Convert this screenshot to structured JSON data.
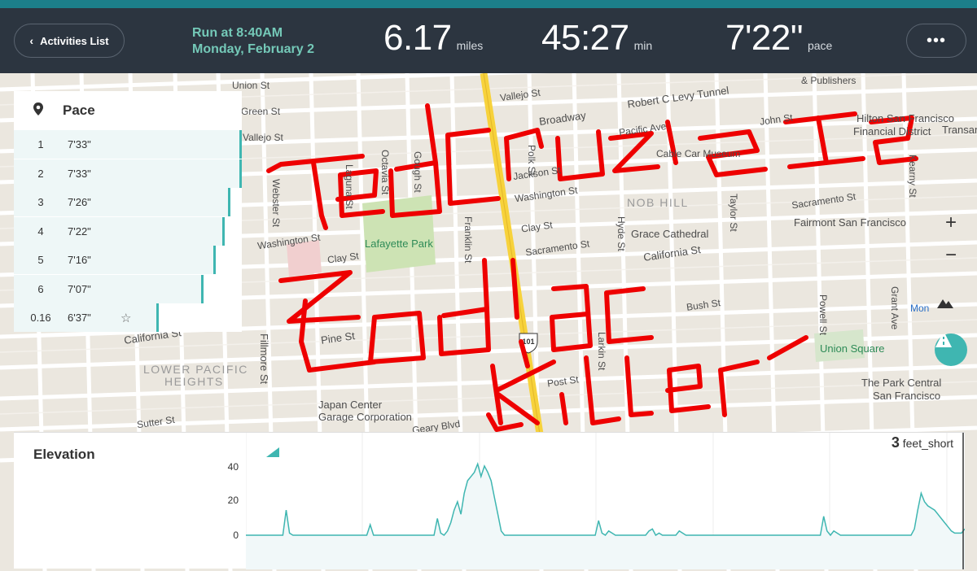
{
  "topbar": {
    "back_label": "Activities List",
    "run_title": "Run at 8:40AM",
    "run_date": "Monday, February 2",
    "distance_value": "6.17",
    "distance_unit": "miles",
    "duration_value": "45:27",
    "duration_unit": "min",
    "pace_value": "7'22\"",
    "pace_unit": "pace",
    "more_label": "•••"
  },
  "pace_panel": {
    "title": "Pace",
    "rows": [
      {
        "mile": "1",
        "pace": "7'33\"",
        "bar_fraction": 0.0
      },
      {
        "mile": "2",
        "pace": "7'33\"",
        "bar_fraction": 0.0
      },
      {
        "mile": "3",
        "pace": "7'26\"",
        "bar_fraction": 0.12
      },
      {
        "mile": "4",
        "pace": "7'22\"",
        "bar_fraction": 0.19
      },
      {
        "mile": "5",
        "pace": "7'16\"",
        "bar_fraction": 0.28
      },
      {
        "mile": "6",
        "pace": "7'07\"",
        "bar_fraction": 0.42
      },
      {
        "mile": "0.16",
        "pace": "6'37\"",
        "bar_fraction": 0.9
      }
    ]
  },
  "map": {
    "streets": [
      "Union St",
      "Green St",
      "Vallejo St",
      "Broadway",
      "Vallejo St",
      "Robert C Levy Tunnel",
      "Pacific Ave",
      "Cable Car Museum",
      "John St",
      "Hilton San Francisco",
      "Financial District",
      "Transam",
      "& Publishers",
      "Jackson St",
      "Washington St",
      "NOB HILL",
      "Sacramento St",
      "Fairmont San Francisco",
      "Clay St",
      "Grace Cathedral",
      "California St",
      "Sacramento St",
      "Washington St",
      "Lafayette Park",
      "Clay St",
      "Webster St",
      "Laguna St",
      "Octavia St",
      "Gough St",
      "Franklin St",
      "Polk St",
      "Hyde St",
      "Larkin St",
      "Taylor St",
      "Powell St",
      "Kearny St",
      "Grant Ave",
      "Pine St",
      "Bush St",
      "Post St",
      "Sutter St",
      "Geary Blvd",
      "Fillmore St",
      "California St",
      "LOWER PACIFIC",
      "HEIGHTS",
      "Japan Center",
      "Garage Corporation",
      "Union Square",
      "The Park Central",
      "San Francisco",
      "101",
      "Mon"
    ],
    "zoom_in": "+",
    "zoom_out": "−",
    "drawing_words": [
      "TedCruz Is",
      "Zodiac",
      "Killer"
    ],
    "route_color": "#ee0000"
  },
  "elevation": {
    "title": "Elevation",
    "cursor_value": "3",
    "cursor_unit": "feet_short",
    "y_ticks": [
      "40",
      "20",
      "0"
    ],
    "ylim": [
      0,
      45
    ],
    "profile": [
      0,
      0,
      0,
      0,
      0,
      0,
      0,
      0,
      0,
      0,
      0,
      0,
      12,
      1,
      0,
      0,
      0,
      0,
      0,
      0,
      0,
      0,
      0,
      0,
      0,
      0,
      0,
      0,
      0,
      0,
      0,
      0,
      0,
      0,
      0,
      0,
      0,
      5,
      0,
      0,
      0,
      0,
      0,
      0,
      0,
      0,
      0,
      0,
      0,
      0,
      0,
      0,
      0,
      0,
      0,
      0,
      0,
      8,
      1,
      0,
      2,
      6,
      12,
      16,
      10,
      20,
      26,
      28,
      30,
      34,
      28,
      33,
      30,
      26,
      18,
      10,
      2,
      0,
      0,
      0,
      0,
      0,
      0,
      0,
      0,
      0,
      0,
      0,
      0,
      0,
      0,
      0,
      0,
      0,
      0,
      0,
      0,
      0,
      0,
      0,
      0,
      0,
      0,
      0,
      0,
      7,
      1,
      0,
      2,
      1,
      0,
      0,
      0,
      0,
      0,
      0,
      0,
      0,
      0,
      0,
      2,
      3,
      0,
      1,
      0,
      0,
      0,
      0,
      0,
      2,
      1,
      0,
      0,
      0,
      0,
      0,
      0,
      0,
      0,
      0,
      0,
      0,
      0,
      0,
      0,
      0,
      0,
      0,
      0,
      0,
      0,
      0,
      0,
      0,
      0,
      0,
      0,
      0,
      0,
      0,
      0,
      0,
      0,
      0,
      0,
      0,
      0,
      0,
      0,
      0,
      0,
      0,
      9,
      2,
      0,
      2,
      1,
      0,
      0,
      0,
      0,
      0,
      0,
      0,
      0,
      0,
      0,
      0,
      0,
      0,
      0,
      0,
      0,
      0,
      0,
      0,
      0,
      0,
      0,
      3,
      12,
      20,
      16,
      14,
      13,
      12,
      10,
      8,
      6,
      4,
      2,
      1,
      1,
      1,
      3
    ]
  },
  "colors": {
    "topbar_bg": "#2c3540",
    "accent_teal": "#74c9b8",
    "elevation_line": "#3fb6b1",
    "route_red": "#ee0000"
  }
}
